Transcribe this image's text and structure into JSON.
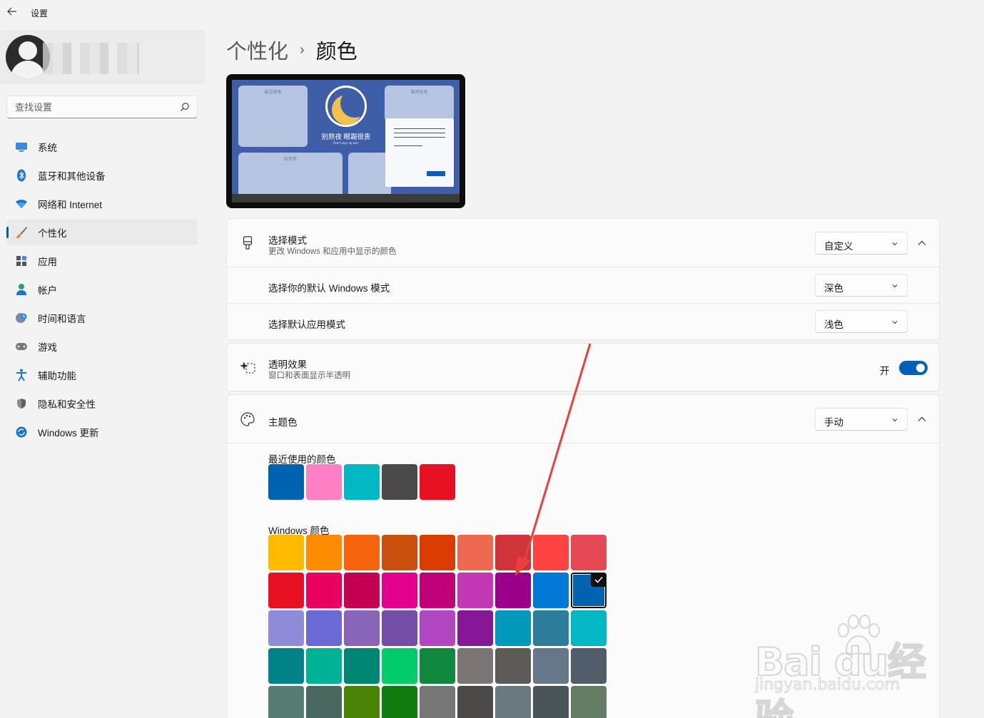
{
  "titlebar": {
    "title": "设置"
  },
  "sidebar": {
    "search_placeholder": "查找设置",
    "items": [
      {
        "label": "系统",
        "icon": "monitor-icon",
        "active": false
      },
      {
        "label": "蓝牙和其他设备",
        "icon": "bluetooth-icon",
        "active": false
      },
      {
        "label": "网络和 Internet",
        "icon": "wifi-icon",
        "active": false
      },
      {
        "label": "个性化",
        "icon": "brush-icon",
        "active": true
      },
      {
        "label": "应用",
        "icon": "apps-icon",
        "active": false
      },
      {
        "label": "帐户",
        "icon": "account-icon",
        "active": false
      },
      {
        "label": "时间和语言",
        "icon": "globe-clock-icon",
        "active": false
      },
      {
        "label": "游戏",
        "icon": "gamepad-icon",
        "active": false
      },
      {
        "label": "辅助功能",
        "icon": "accessibility-icon",
        "active": false
      },
      {
        "label": "隐私和安全性",
        "icon": "shield-icon",
        "active": false
      },
      {
        "label": "Windows 更新",
        "icon": "update-icon",
        "active": false
      }
    ]
  },
  "breadcrumb": {
    "parent": "个性化",
    "separator": "›",
    "current": "颜色"
  },
  "preview": {
    "tile_labels": [
      "最近使用",
      "临时任务",
      "软件库"
    ],
    "title": "别熬夜 眼霜很贵",
    "subtitle": "Don't stay up late."
  },
  "mode_card": {
    "title": "选择模式",
    "subtitle": "更改 Windows 和应用中显示的颜色",
    "value": "自定义",
    "windows_mode_label": "选择你的默认 Windows 模式",
    "windows_mode_value": "深色",
    "app_mode_label": "选择默认应用模式",
    "app_mode_value": "浅色"
  },
  "transparency": {
    "title": "透明效果",
    "subtitle": "窗口和表面显示半透明",
    "state_label": "开",
    "on": true
  },
  "accent": {
    "title": "主题色",
    "value": "手动",
    "recent_label": "最近使用的颜色",
    "recent_colors": [
      "#0063b1",
      "#ff7fc4",
      "#00b7c3",
      "#4c4a48",
      "#e81123"
    ],
    "windows_label": "Windows 颜色",
    "windows_colors": [
      [
        "#ffb900",
        "#ff8c00",
        "#f7630c",
        "#ca5010",
        "#da3b01",
        "#ef6950",
        "#d13438",
        "#ff4343",
        "#e74856"
      ],
      [
        "#e81123",
        "#ea005e",
        "#c30052",
        "#e3008c",
        "#bf0077",
        "#c239b3",
        "#9a0089",
        "#0078d7",
        "#0063b1"
      ],
      [
        "#8e8cd8",
        "#6b69d6",
        "#8764b8",
        "#744da9",
        "#b146c2",
        "#881798",
        "#0099bc",
        "#2d7d9a",
        "#00b7c3"
      ],
      [
        "#038387",
        "#00b294",
        "#018574",
        "#00cc6a",
        "#10893e",
        "#7a7574",
        "#5d5a58",
        "#68768a",
        "#515c6b"
      ],
      [
        "#567c73",
        "#486860",
        "#498205",
        "#107c10",
        "#767676",
        "#4c4a48",
        "#69797e",
        "#4a5459",
        "#647c64"
      ]
    ],
    "selected": [
      1,
      8
    ]
  },
  "colors": {
    "accent": "#005fb8",
    "annotation_arrow": "#e8403a"
  }
}
